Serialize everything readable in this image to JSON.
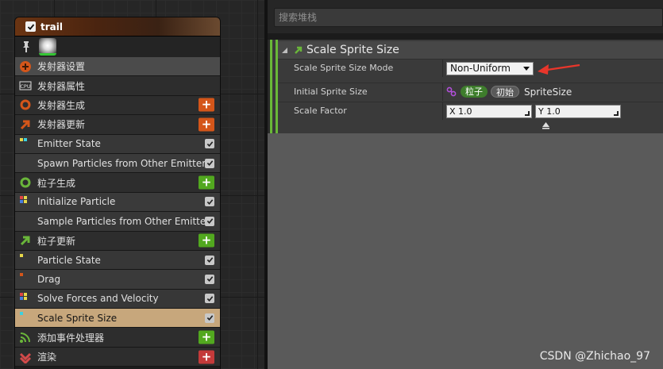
{
  "node": {
    "title": "trail",
    "rows": [
      {
        "label": "发射器设置",
        "kind": "top",
        "icon": "emitter-settings-icon"
      },
      {
        "label": "发射器属性",
        "kind": "section",
        "icon": "cpu-icon",
        "icon_text": "CPU"
      },
      {
        "label": "发射器生成",
        "kind": "section",
        "icon": "spawn-ring-icon",
        "action": "add-orange"
      },
      {
        "label": "发射器更新",
        "kind": "section",
        "icon": "update-arrow-icon",
        "action": "add-orange"
      },
      {
        "label": "Emitter State",
        "kind": "module",
        "icon": "module-dots-icon",
        "checked": true
      },
      {
        "label": "Spawn Particles from Other Emitter",
        "kind": "module",
        "checked": true
      },
      {
        "label": "粒子生成",
        "kind": "section",
        "icon": "particle-spawn-ring-icon",
        "action": "add-green"
      },
      {
        "label": "Initialize Particle",
        "kind": "module",
        "icon": "module-dots-icon",
        "checked": true
      },
      {
        "label": "Sample Particles from Other Emitter",
        "kind": "module",
        "checked": true
      },
      {
        "label": "粒子更新",
        "kind": "section",
        "icon": "particle-update-arrow-icon",
        "action": "add-green"
      },
      {
        "label": "Particle State",
        "kind": "module",
        "icon": "module-dots-icon",
        "checked": true
      },
      {
        "label": "Drag",
        "kind": "module",
        "icon": "module-dots-icon",
        "checked": true
      },
      {
        "label": "Solve Forces and Velocity",
        "kind": "module",
        "icon": "module-dots-icon",
        "checked": true
      },
      {
        "label": "Scale Sprite Size",
        "kind": "selected",
        "icon": "module-dots-icon",
        "checked": true
      },
      {
        "label": "添加事件处理器",
        "kind": "section",
        "icon": "event-handler-icon",
        "action": "add-green"
      },
      {
        "label": "渲染",
        "kind": "section",
        "icon": "render-icon",
        "action": "add-red"
      }
    ]
  },
  "panel": {
    "search_placeholder": "搜索堆栈",
    "category_title": "Scale Sprite Size",
    "props": {
      "mode_label": "Scale Sprite Size Mode",
      "mode_value": "Non-Uniform",
      "initial_label": "Initial Sprite Size",
      "initial_tag1": "粒子",
      "initial_tag2": "初始",
      "initial_value": "SpriteSize",
      "factor_label": "Scale Factor",
      "factor_x": "X 1.0",
      "factor_y": "Y 1.0"
    }
  },
  "watermark": "CSDN @Zhichao_97",
  "colors": {
    "accent_green": "#69b838",
    "add_orange": "#d4561a",
    "add_green": "#52a81f",
    "add_red": "#c43a3a",
    "selected_row": "#c7a77c",
    "annotation_arrow": "#e8362b"
  }
}
